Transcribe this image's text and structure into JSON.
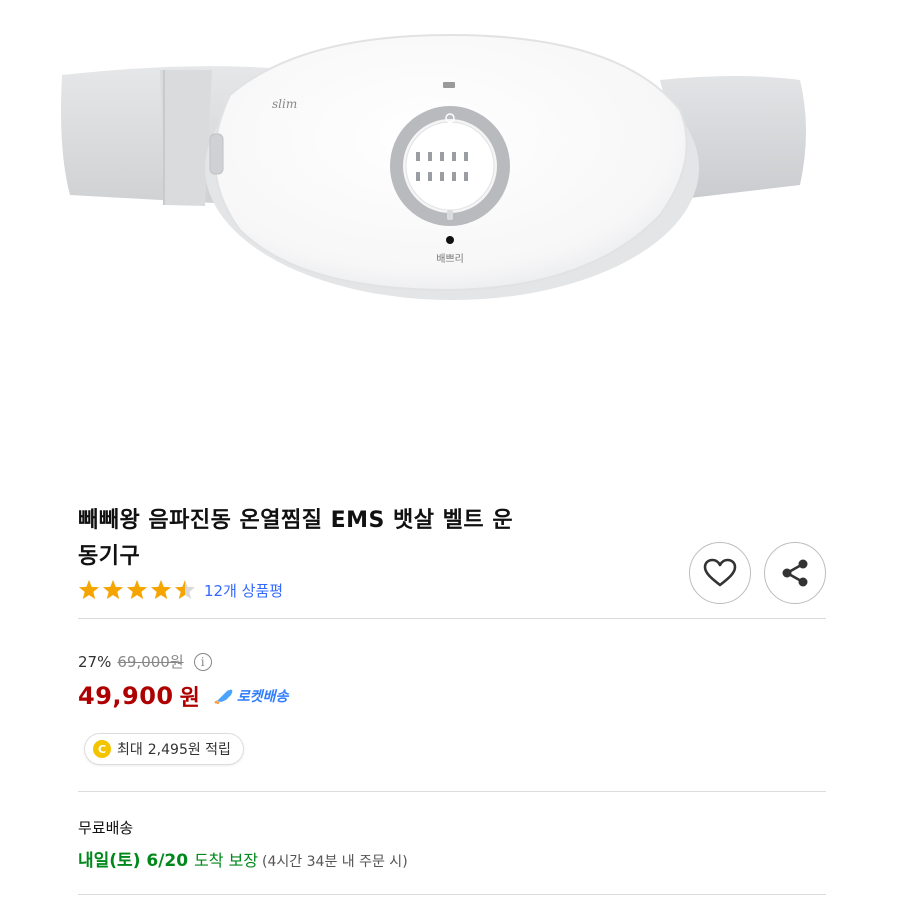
{
  "product": {
    "brand_logo": "slim",
    "device_label": "배쁘리",
    "title_line1": "빼빼왕 음파진동 온열찜질 EMS 뱃살 벨트 운",
    "title_line2": "동기구",
    "rating": 4.5,
    "review_count_text": "12개 상품평"
  },
  "actions": {
    "wishlist_icon": "heart-icon",
    "share_icon": "share-icon"
  },
  "price": {
    "discount_rate": "27%",
    "original_price": "69,000원",
    "info_icon_text": "i",
    "sale_price": "49,900",
    "currency": "원",
    "rocket_label": "로켓배송"
  },
  "reward": {
    "coin_text": "C",
    "label": "최대",
    "amount_text": "2,495원 적립"
  },
  "shipping": {
    "label": "무료배송",
    "date": "내일(토) 6/20",
    "guarantee": "도착 보장",
    "note": "(4시간 34분 내 주문 시)"
  },
  "colors": {
    "accent_price": "#ae0000",
    "link_blue": "#346aff",
    "rocket_blue": "#2f7dff",
    "ship_green": "#00891a",
    "star_gold": "#f6a500"
  }
}
